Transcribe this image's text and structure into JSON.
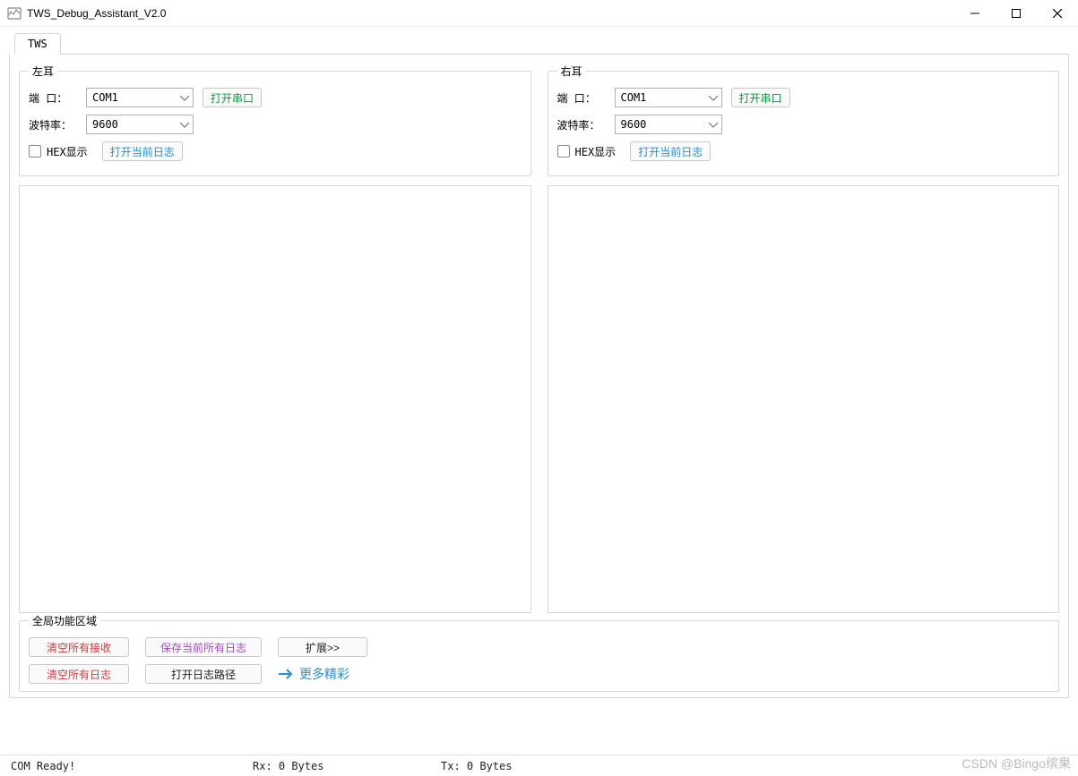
{
  "window": {
    "title": "TWS_Debug_Assistant_V2.0"
  },
  "tabs": [
    {
      "label": "TWS"
    }
  ],
  "left": {
    "legend": "左耳",
    "port_label": "端  口：",
    "port_value": "COM1",
    "open_port_btn": "打开串口",
    "baud_label": "波特率：",
    "baud_value": "9600",
    "hex_label": "HEX显示",
    "hex_checked": false,
    "open_log_btn": "打开当前日志"
  },
  "right": {
    "legend": "右耳",
    "port_label": "端  口：",
    "port_value": "COM1",
    "open_port_btn": "打开串口",
    "baud_label": "波特率：",
    "baud_value": "9600",
    "hex_label": "HEX显示",
    "hex_checked": false,
    "open_log_btn": "打开当前日志"
  },
  "global": {
    "legend": "全局功能区域",
    "clear_all_rx": "清空所有接收",
    "save_all_logs": "保存当前所有日志",
    "expand_btn": "扩展>>",
    "clear_all_logs": "清空所有日志",
    "open_log_path": "打开日志路径",
    "more_link": "更多精彩"
  },
  "status": {
    "com": "COM Ready!",
    "rx": "Rx: 0 Bytes",
    "tx": "Tx: 0 Bytes"
  },
  "watermark": "CSDN @Bingo缤果"
}
